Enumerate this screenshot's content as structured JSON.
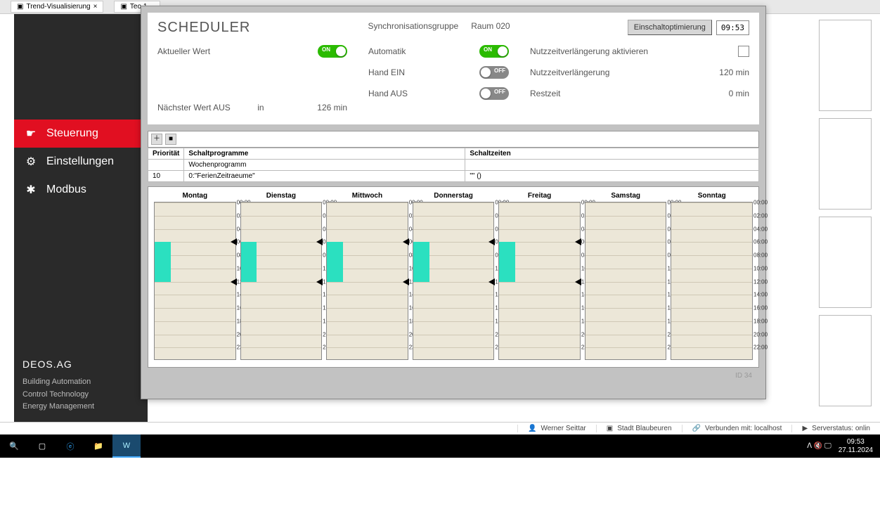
{
  "tabs": {
    "t1": "Trend-Visualisierung",
    "t1_icon": "▣",
    "t2": "Teo 1…"
  },
  "sidebar": {
    "items": [
      {
        "icon": "☛",
        "label": "Steuerung"
      },
      {
        "icon": "⚙",
        "label": "Einstellungen"
      },
      {
        "icon": "✱",
        "label": "Modbus"
      }
    ],
    "logo": "DEOS.AG",
    "f1": "Building Automation",
    "f2": "Control Technology",
    "f3": "Energy Management"
  },
  "dialog": {
    "title": "SCHEDULER",
    "sync_label": "Synchronisationsgruppe",
    "sync_value": "Raum 020",
    "opt_btn": "Einschaltoptimierung",
    "time": "09:53",
    "left": {
      "current_label": "Aktueller Wert",
      "next_label": "Nächster Wert AUS",
      "next_in": "in",
      "next_val": "126  min"
    },
    "mid": {
      "auto": "Automatik",
      "hand_on": "Hand EIN",
      "hand_off": "Hand AUS"
    },
    "right": {
      "ext_act": "Nutzzeitverlängerung aktivieren",
      "ext": "Nutzzeitverlängerung",
      "ext_val": "120  min",
      "rest": "Restzeit",
      "rest_val": "0  min"
    },
    "table": {
      "h1": "Priorität",
      "h2": "Schaltprogramme",
      "h3": "Schaltzeiten",
      "r1c2": "Wochenprogramm",
      "r2c1": "10",
      "r2c2": "0:\"FerienZeitraeume\"",
      "r2c3": "\"\" ()"
    },
    "days": [
      "Montag",
      "Dienstag",
      "Mittwoch",
      "Donnerstag",
      "Freitag",
      "Samstag",
      "Sonntag"
    ],
    "ticks": [
      "00:00",
      "02:00",
      "04:00",
      "06:00",
      "08:00",
      "10:00",
      "12:00",
      "14:00",
      "16:00",
      "18:00",
      "20:00",
      "22:00"
    ],
    "footer_id": "ID 34",
    "toggle_on": "ON",
    "toggle_off": "OFF"
  },
  "statusbar": {
    "user": "Werner Seittar",
    "city": "Stadt Blaubeuren",
    "conn": "Verbunden mit: localhost",
    "server": "Serverstatus: onlin"
  },
  "taskbar": {
    "time": "09:53",
    "date": "27.11.2024",
    "tray": "ᐱ 🔇 🖵"
  }
}
